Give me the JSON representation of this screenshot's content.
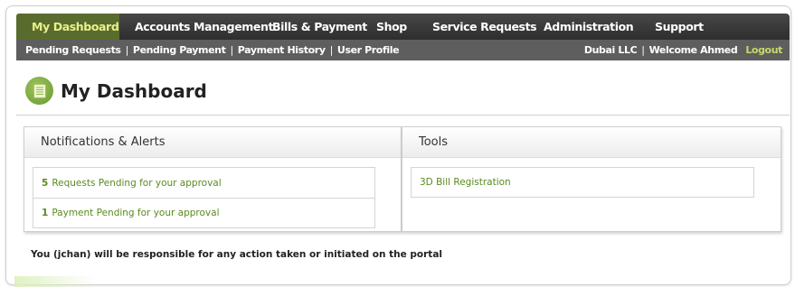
{
  "nav": {
    "tabs": [
      {
        "label": "My Dashboard"
      },
      {
        "label": "Accounts Management"
      },
      {
        "label": "Bills & Payment"
      },
      {
        "label": "Shop"
      },
      {
        "label": "Service Requests"
      },
      {
        "label": "Administration"
      },
      {
        "label": "Support"
      }
    ],
    "active_tab": "My Dashboard"
  },
  "subnav": {
    "links": [
      {
        "label": "Pending Requests"
      },
      {
        "label": "Pending Payment"
      },
      {
        "label": "Payment History"
      },
      {
        "label": "User Profile"
      }
    ],
    "company": "Dubai LLC",
    "welcome": "Welcome Ahmed",
    "logout": "Logout"
  },
  "page": {
    "title": "My Dashboard",
    "icon": "dashboard-document-icon"
  },
  "notifications": {
    "title": "Notifications & Alerts",
    "items": [
      {
        "count": "5",
        "text": "Requests Pending for your approval"
      },
      {
        "count": "1",
        "text": "Payment Pending for your approval"
      }
    ]
  },
  "tools": {
    "title": "Tools",
    "items": [
      {
        "label": "3D Bill Registration"
      }
    ]
  },
  "disclaimer": "You (jchan) will be responsible for any action taken or initiated on the portal",
  "colors": {
    "active_tab_bg": "#5a6b2e",
    "active_tab_text": "#e8f08a",
    "link_green": "#5a8a1f",
    "logout": "#c8d86a",
    "nav_bg": "#3a3a3a",
    "subnav_bg": "#5e5e5e"
  }
}
